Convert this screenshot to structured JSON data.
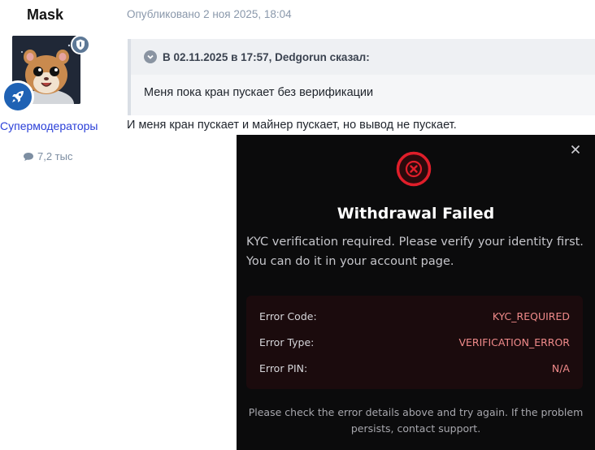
{
  "post": {
    "author_name": "Mask",
    "user_group": "Супермодераторы",
    "message_count": "7,2 тыс",
    "published": "Опубликовано 2 ноя 2025, 18:04",
    "quote_header": "В 02.11.2025 в 17:57, Dedgorun сказал:",
    "quote_text": "Меня пока кран пускает без верификации",
    "body_text": "И меня кран пускает и майнер пускает, но вывод не пускает."
  },
  "modal": {
    "title": "Withdrawal Failed",
    "message_line1": "KYC verification required. Please verify your identity first.",
    "message_line2": "You can do it in your account page.",
    "details": [
      {
        "label": "Error Code:",
        "value": "KYC_REQUIRED"
      },
      {
        "label": "Error Type:",
        "value": "VERIFICATION_ERROR"
      },
      {
        "label": "Error PIN:",
        "value": "N/A"
      }
    ],
    "footer_line1": "Please check the error details above and try again. If the problem",
    "footer_line2": "persists, contact support."
  },
  "colors": {
    "accent_error": "#e01e2a",
    "group_link": "#2a3fd8",
    "modal_bg": "#0b0b0c",
    "details_bg": "#1b0b0d",
    "detail_value": "#f08a8a"
  },
  "icons": [
    "shield-icon",
    "rocket-icon",
    "speech-bubble-icon",
    "chevron-down-icon",
    "close-icon",
    "error-x-icon"
  ]
}
